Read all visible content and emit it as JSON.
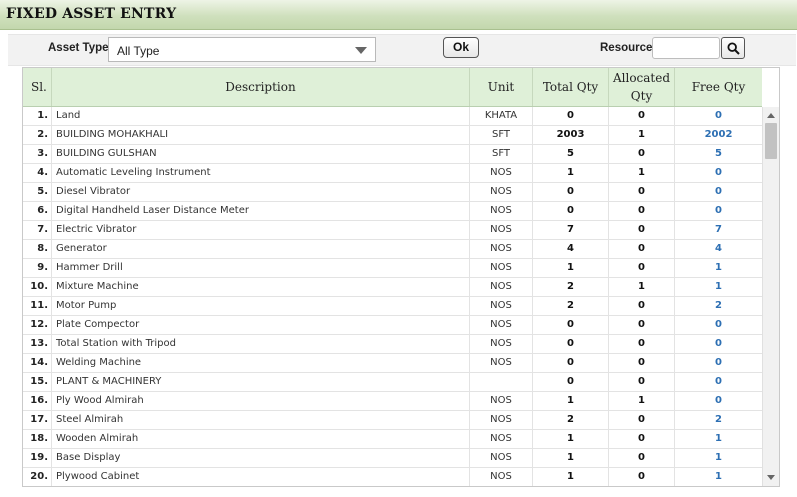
{
  "page": {
    "title": "FIXED ASSET ENTRY"
  },
  "filters": {
    "asset_type_label": "Asset Type",
    "asset_type_value": "All Type",
    "ok_label": "Ok",
    "resource_label": "Resource",
    "resource_value": ""
  },
  "table": {
    "headers": {
      "sl": "Sl.",
      "description": "Description",
      "unit": "Unit",
      "total_qty": "Total Qty",
      "allocated_qty": "Allocated Qty",
      "free_qty": "Free Qty"
    },
    "rows": [
      {
        "sl": "1.",
        "description": "Land",
        "unit": "KHATA",
        "total": "0",
        "allocated": "0",
        "free": "0"
      },
      {
        "sl": "2.",
        "description": "BUILDING MOHAKHALI",
        "unit": "SFT",
        "total": "2003",
        "allocated": "1",
        "free": "2002"
      },
      {
        "sl": "3.",
        "description": "BUILDING GULSHAN",
        "unit": "SFT",
        "total": "5",
        "allocated": "0",
        "free": "5"
      },
      {
        "sl": "4.",
        "description": "Automatic Leveling Instrument",
        "unit": "NOS",
        "total": "1",
        "allocated": "1",
        "free": "0"
      },
      {
        "sl": "5.",
        "description": "Diesel Vibrator",
        "unit": "NOS",
        "total": "0",
        "allocated": "0",
        "free": "0"
      },
      {
        "sl": "6.",
        "description": "Digital Handheld Laser Distance Meter",
        "unit": "NOS",
        "total": "0",
        "allocated": "0",
        "free": "0"
      },
      {
        "sl": "7.",
        "description": "Electric Vibrator",
        "unit": "NOS",
        "total": "7",
        "allocated": "0",
        "free": "7"
      },
      {
        "sl": "8.",
        "description": "Generator",
        "unit": "NOS",
        "total": "4",
        "allocated": "0",
        "free": "4"
      },
      {
        "sl": "9.",
        "description": "Hammer Drill",
        "unit": "NOS",
        "total": "1",
        "allocated": "0",
        "free": "1"
      },
      {
        "sl": "10.",
        "description": "Mixture Machine",
        "unit": "NOS",
        "total": "2",
        "allocated": "1",
        "free": "1"
      },
      {
        "sl": "11.",
        "description": "Motor Pump",
        "unit": "NOS",
        "total": "2",
        "allocated": "0",
        "free": "2"
      },
      {
        "sl": "12.",
        "description": "Plate Compector",
        "unit": "NOS",
        "total": "0",
        "allocated": "0",
        "free": "0"
      },
      {
        "sl": "13.",
        "description": "Total Station with Tripod",
        "unit": "NOS",
        "total": "0",
        "allocated": "0",
        "free": "0"
      },
      {
        "sl": "14.",
        "description": "Welding Machine",
        "unit": "NOS",
        "total": "0",
        "allocated": "0",
        "free": "0"
      },
      {
        "sl": "15.",
        "description": "PLANT & MACHINERY",
        "unit": "",
        "total": "0",
        "allocated": "0",
        "free": "0"
      },
      {
        "sl": "16.",
        "description": "Ply Wood Almirah",
        "unit": "NOS",
        "total": "1",
        "allocated": "1",
        "free": "0"
      },
      {
        "sl": "17.",
        "description": "Steel Almirah",
        "unit": "NOS",
        "total": "2",
        "allocated": "0",
        "free": "2"
      },
      {
        "sl": "18.",
        "description": "Wooden Almirah",
        "unit": "NOS",
        "total": "1",
        "allocated": "0",
        "free": "1"
      },
      {
        "sl": "19.",
        "description": "Base Display",
        "unit": "NOS",
        "total": "1",
        "allocated": "0",
        "free": "1"
      },
      {
        "sl": "20.",
        "description": "Plywood Cabinet",
        "unit": "NOS",
        "total": "1",
        "allocated": "0",
        "free": "1"
      }
    ]
  },
  "icons": {
    "search": "search-icon",
    "dropdown": "chevron-down-icon"
  },
  "colors": {
    "header_bg": "#dff0d8",
    "title_bar": "#c3d7ad",
    "free_qty": "#2d6fb3"
  }
}
